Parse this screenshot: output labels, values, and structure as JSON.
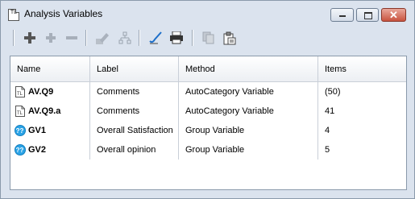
{
  "window": {
    "title": "Analysis Variables",
    "app_icon_text": "TL"
  },
  "toolbar": {
    "buttons": [
      {
        "name": "add-icon"
      },
      {
        "name": "add-child-icon"
      },
      {
        "name": "remove-icon"
      },
      {
        "name": "edit-icon"
      },
      {
        "name": "hierarchy-icon"
      },
      {
        "name": "check-icon"
      },
      {
        "name": "print-icon"
      },
      {
        "name": "copy-icon"
      },
      {
        "name": "paste-icon"
      }
    ]
  },
  "grid": {
    "columns": [
      "Name",
      "Label",
      "Method",
      "Items"
    ],
    "rows": [
      {
        "icon": "text-variable-icon",
        "name": "AV.Q9",
        "label": "Comments",
        "method": "AutoCategory Variable",
        "items": "(50)"
      },
      {
        "icon": "text-variable-icon",
        "name": "AV.Q9.a",
        "label": "Comments",
        "method": "AutoCategory Variable",
        "items": "41"
      },
      {
        "icon": "group-variable-icon",
        "name": "GV1",
        "label": "Overall Satisfaction",
        "method": "Group Variable",
        "items": "4"
      },
      {
        "icon": "group-variable-icon",
        "name": "GV2",
        "label": "Overall opinion",
        "method": "Group Variable",
        "items": "5"
      }
    ]
  },
  "colors": {
    "chrome": "#dbe3ee",
    "close_button": "#c8533f",
    "group_icon": "#2aa3e6"
  }
}
